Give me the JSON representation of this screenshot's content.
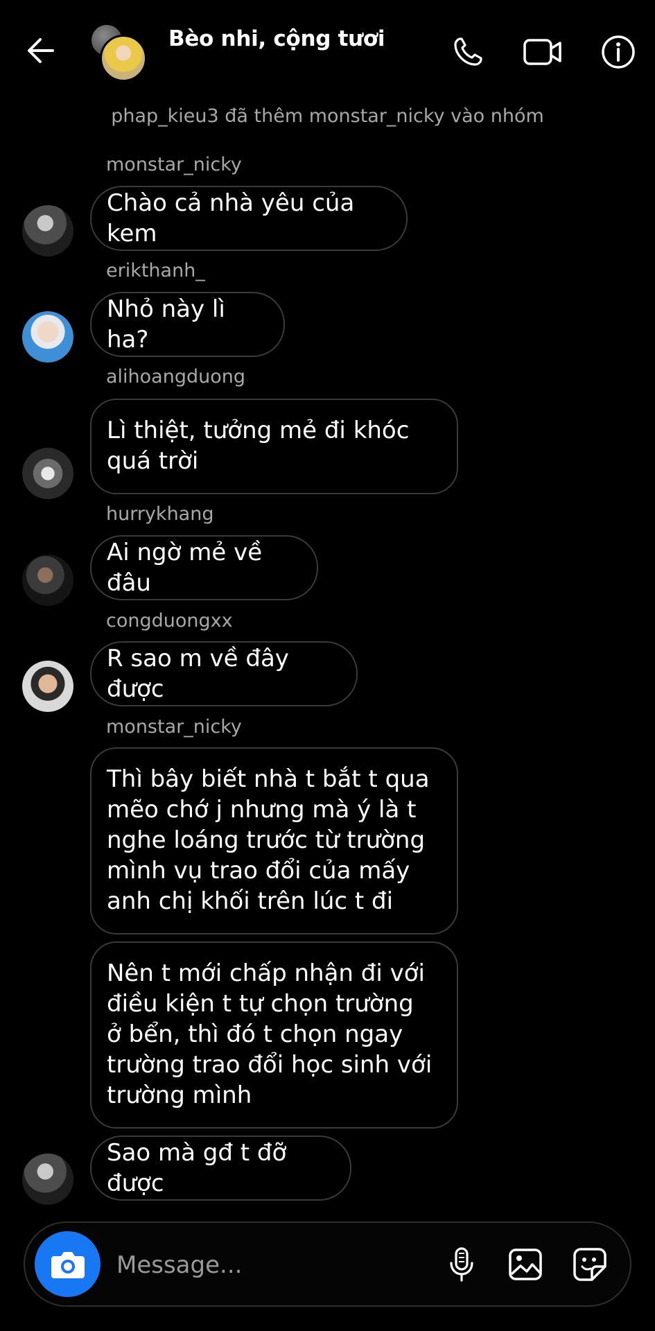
{
  "header": {
    "title": "Bèo nhi, cộng tươi",
    "icons": [
      "back-arrow-icon",
      "phone-icon",
      "video-camera-icon",
      "info-icon"
    ]
  },
  "system_message": "phap_kieu3 đã thêm monstar_nicky vào nhóm",
  "messages": [
    {
      "sender": "monstar_nicky",
      "lines": [
        "Chào cả nhà yêu của kem"
      ]
    },
    {
      "sender": "erikthanh_",
      "lines": [
        "Nhỏ này lì ha?"
      ]
    },
    {
      "sender": "alihoangduong",
      "lines": [
        "Lì thiệt, tưởng mẻ đi khóc",
        "quá trời"
      ]
    },
    {
      "sender": "hurrykhang",
      "lines": [
        "Ai ngờ mẻ về đâu"
      ]
    },
    {
      "sender": "congduongxx",
      "lines": [
        "R sao m về đây được"
      ]
    },
    {
      "sender": "monstar_nicky",
      "lines": [
        "Thì bây biết nhà t bắt t qua",
        "mẽo chớ j nhưng mà ý là t",
        "nghe loáng trước từ trường",
        "mình vụ trao đổi của mấy",
        "anh chị khối trên lúc t đi"
      ]
    },
    {
      "sender": "",
      "lines": [
        "Nên t mới chấp nhận đi với",
        "điều kiện t tự chọn trường",
        "ở bển, thì đó t chọn ngay",
        "trường trao đổi học sinh với",
        "trường mình"
      ]
    },
    {
      "sender": "",
      "lines": [
        "Sao mà gđ t đỡ được"
      ]
    }
  ],
  "composer": {
    "placeholder": "Message...",
    "icons": [
      "camera-icon",
      "microphone-icon",
      "gallery-icon",
      "sticker-icon"
    ],
    "camera_color": "#1877f2"
  }
}
